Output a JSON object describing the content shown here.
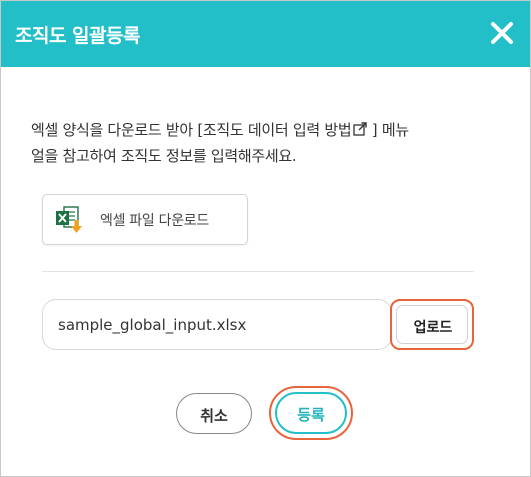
{
  "dialog": {
    "title": "조직도 일괄등록",
    "close_icon": "close-icon"
  },
  "description": {
    "line1_prefix": "엑셀 양식을 다운로드 받아 [조직도 데이터 입력 방법",
    "line1_suffix": " ] 메뉴",
    "line2": "얼을 참고하여 조직도 정보를 입력해주세요.",
    "link_icon": "external-link-icon"
  },
  "excel_download": {
    "label": "엑셀 파일 다운로드",
    "icon": "excel-download-icon"
  },
  "file": {
    "name": "sample_global_input.xlsx"
  },
  "buttons": {
    "upload": "업로드",
    "cancel": "취소",
    "confirm": "등록"
  },
  "colors": {
    "header": "#22bfc8",
    "highlight": "#e8643a",
    "excel_green": "#1e7145",
    "download_arrow": "#f0a020"
  }
}
